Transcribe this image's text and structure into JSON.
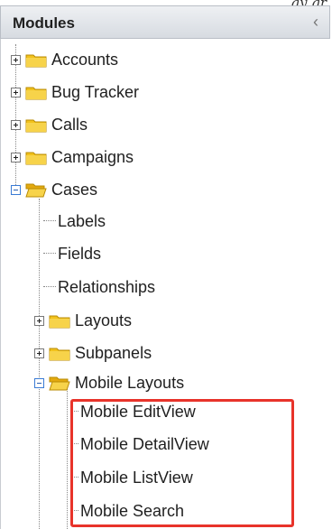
{
  "caption": "gy gr",
  "header": {
    "title": "Modules",
    "collapse_glyph": "‹"
  },
  "modules": [
    {
      "label": "Accounts"
    },
    {
      "label": "Bug Tracker"
    },
    {
      "label": "Calls"
    },
    {
      "label": "Campaigns"
    },
    {
      "label": "Cases"
    }
  ],
  "cases_children": [
    {
      "label": "Labels"
    },
    {
      "label": "Fields"
    },
    {
      "label": "Relationships"
    },
    {
      "label": "Layouts"
    },
    {
      "label": "Subpanels"
    },
    {
      "label": "Mobile Layouts"
    }
  ],
  "mobile_layouts_children": [
    {
      "label": "Mobile EditView"
    },
    {
      "label": "Mobile DetailView"
    },
    {
      "label": "Mobile ListView"
    },
    {
      "label": "Mobile Search"
    }
  ],
  "colors": {
    "folder": "#f2c21b",
    "highlight": "#e8332a"
  }
}
